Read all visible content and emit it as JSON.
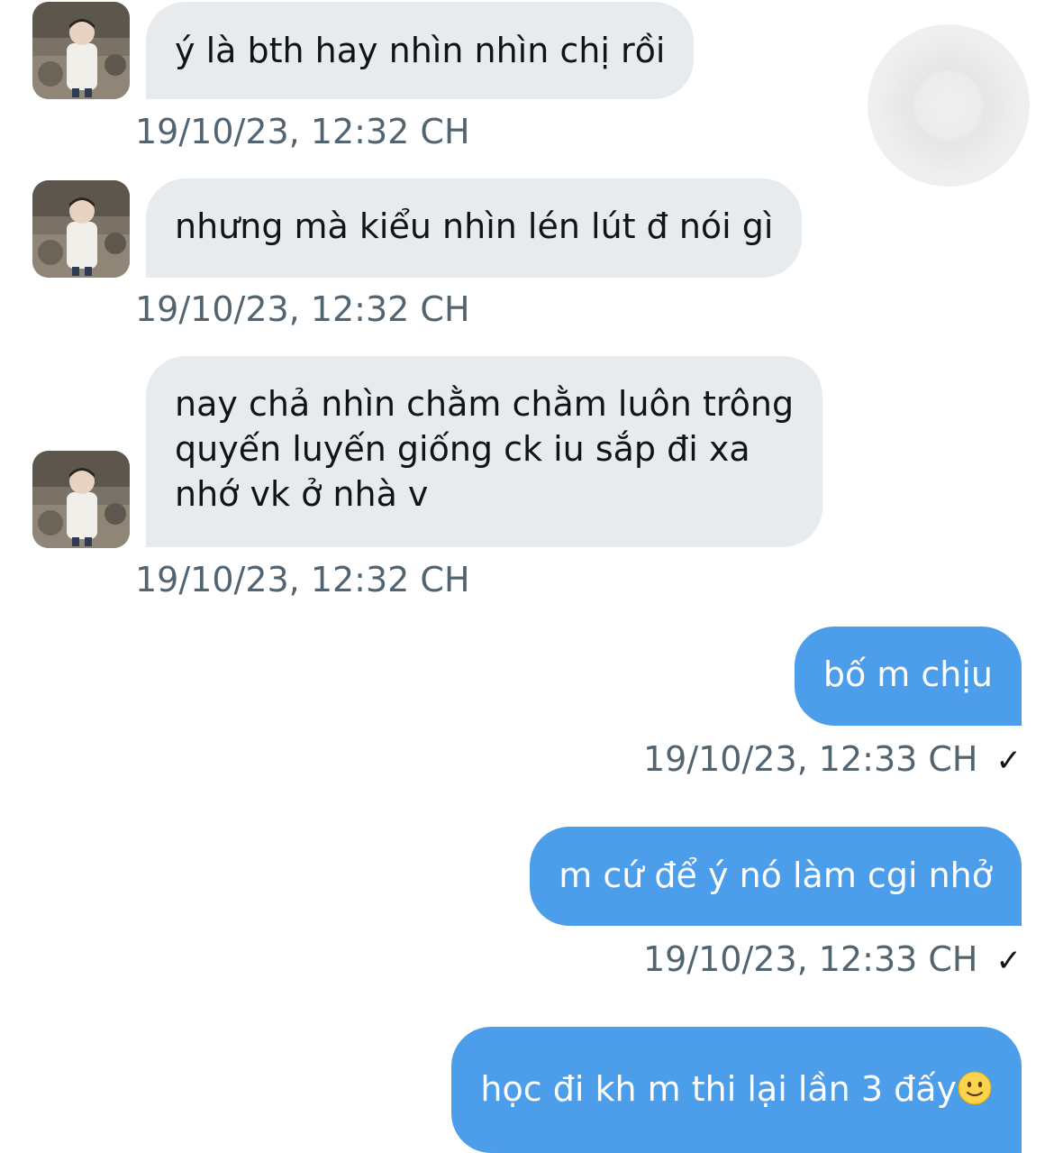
{
  "messages": [
    {
      "direction": "in",
      "lines": [
        "ý là bth hay nhìn nhìn chị rồi"
      ],
      "time": "19/10/23, 12:32 CH"
    },
    {
      "direction": "in",
      "lines": [
        "nhưng mà kiểu nhìn lén lút đ nói gì"
      ],
      "time": "19/10/23, 12:32 CH"
    },
    {
      "direction": "in",
      "lines": [
        "nay chả nhìn chằm chằm luôn trông",
        "quyến luyến giống ck iu sắp đi xa",
        "nhớ vk ở nhà v"
      ],
      "time": "19/10/23, 12:32 CH"
    },
    {
      "direction": "out",
      "lines": [
        "bố m chịu"
      ],
      "time": "19/10/23, 12:33 CH",
      "status_icon": "checkmark-icon"
    },
    {
      "direction": "out",
      "lines": [
        "m cứ để ý nó làm cgi nhở"
      ],
      "time": "19/10/23, 12:33 CH",
      "status_icon": "checkmark-icon"
    },
    {
      "direction": "out",
      "lines": [
        "học đi kh m thi lại lần 3 đấy"
      ],
      "emoji": "slightly-smiling-face-icon"
    }
  ],
  "check_glyph": "✓",
  "colors": {
    "incoming_bubble": "#e7ebee",
    "outgoing_bubble": "#4c9dea",
    "timestamp": "#536471",
    "text": "#0f1419"
  }
}
